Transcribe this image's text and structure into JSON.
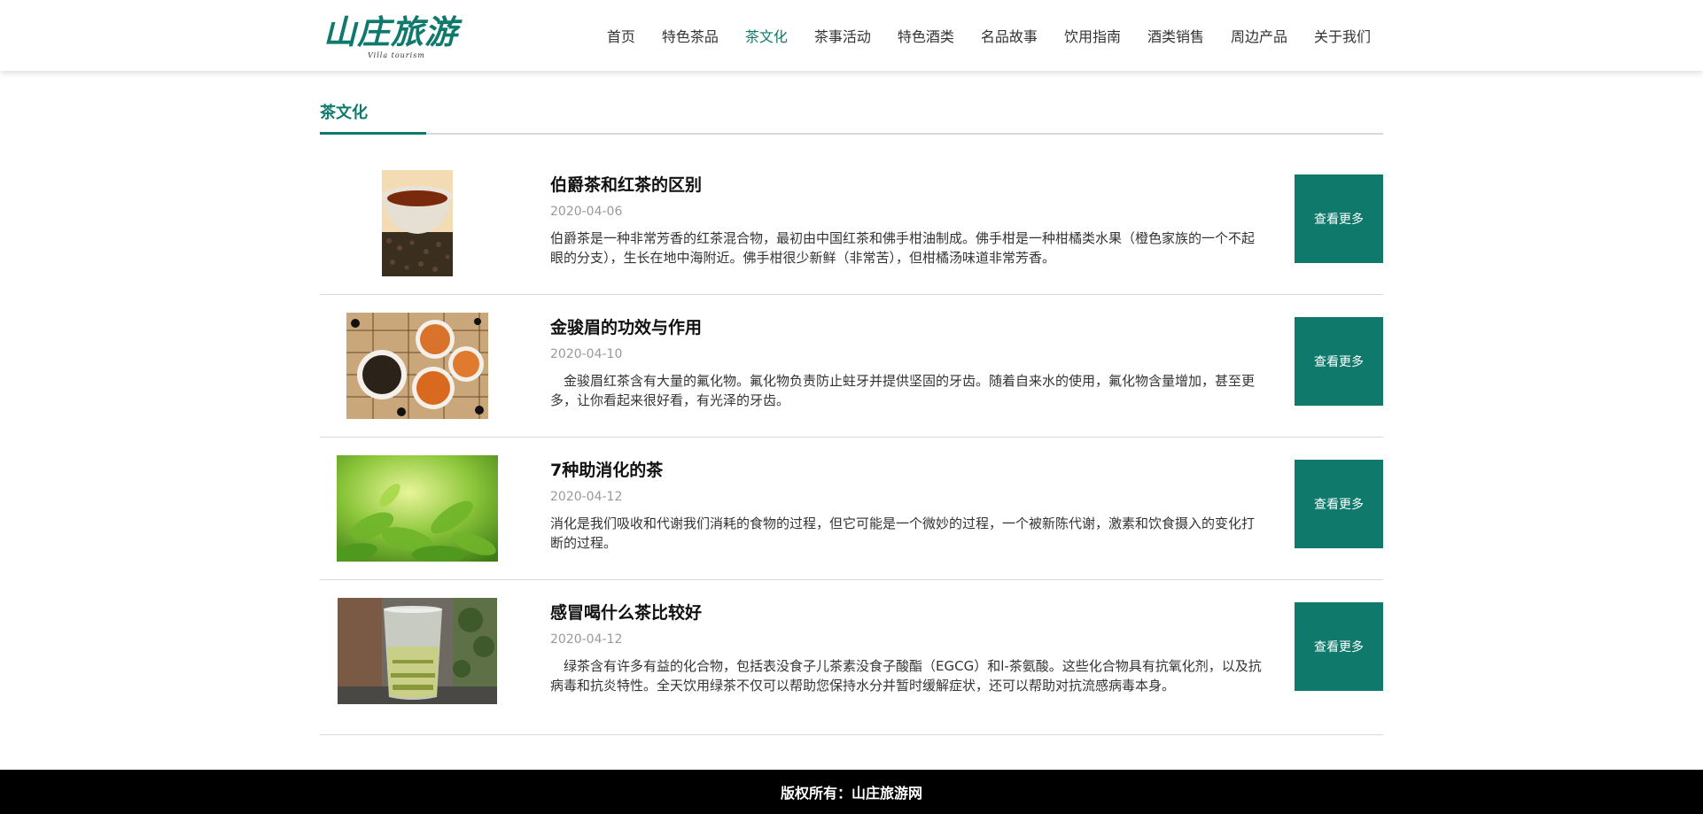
{
  "logo": {
    "title": "山庄旅游",
    "subtitle": "Villa tourism"
  },
  "nav": {
    "items": [
      {
        "label": "首页",
        "active": false
      },
      {
        "label": "特色茶品",
        "active": false
      },
      {
        "label": "茶文化",
        "active": true
      },
      {
        "label": "茶事活动",
        "active": false
      },
      {
        "label": "特色酒类",
        "active": false
      },
      {
        "label": "名品故事",
        "active": false
      },
      {
        "label": "饮用指南",
        "active": false
      },
      {
        "label": "酒类销售",
        "active": false
      },
      {
        "label": "周边产品",
        "active": false
      },
      {
        "label": "关于我们",
        "active": false
      }
    ]
  },
  "section": {
    "title": "茶文化"
  },
  "articles": [
    {
      "title": "伯爵茶和红茶的区别",
      "date": "2020-04-06",
      "desc": "伯爵茶是一种非常芳香的红茶混合物，最初由中国红茶和佛手柑油制成。佛手柑是一种柑橘类水果（橙色家族的一个不起眼的分支），生长在地中海附近。佛手柑很少新鲜（非常苦），但柑橘汤味道非常芳香。",
      "more": "查看更多"
    },
    {
      "title": "金骏眉的功效与作用",
      "date": "2020-04-10",
      "desc": "　金骏眉红茶含有大量的氟化物。氟化物负责防止蛀牙并提供坚固的牙齿。随着自来水的使用，氟化物含量增加，甚至更多，让你看起来很好看，有光泽的牙齿。",
      "more": "查看更多"
    },
    {
      "title": "7种助消化的茶",
      "date": "2020-04-12",
      "desc": "消化是我们吸收和代谢我们消耗的食物的过程，但它可能是一个微妙的过程，一个被新陈代谢，激素和饮食摄入的变化打断的过程。",
      "more": "查看更多"
    },
    {
      "title": "感冒喝什么茶比较好",
      "date": "2020-04-12",
      "desc": "　绿茶含有许多有益的化合物，包括表没食子儿茶素没食子酸酯（EGCG）和l-茶氨酸。这些化合物具有抗氧化剂，以及抗病毒和抗炎特性。全天饮用绿茶不仅可以帮助您保持水分并暂时缓解症状，还可以帮助对抗流感病毒本身。",
      "more": "查看更多"
    }
  ],
  "footer": {
    "text": "版权所有：山庄旅游网"
  }
}
